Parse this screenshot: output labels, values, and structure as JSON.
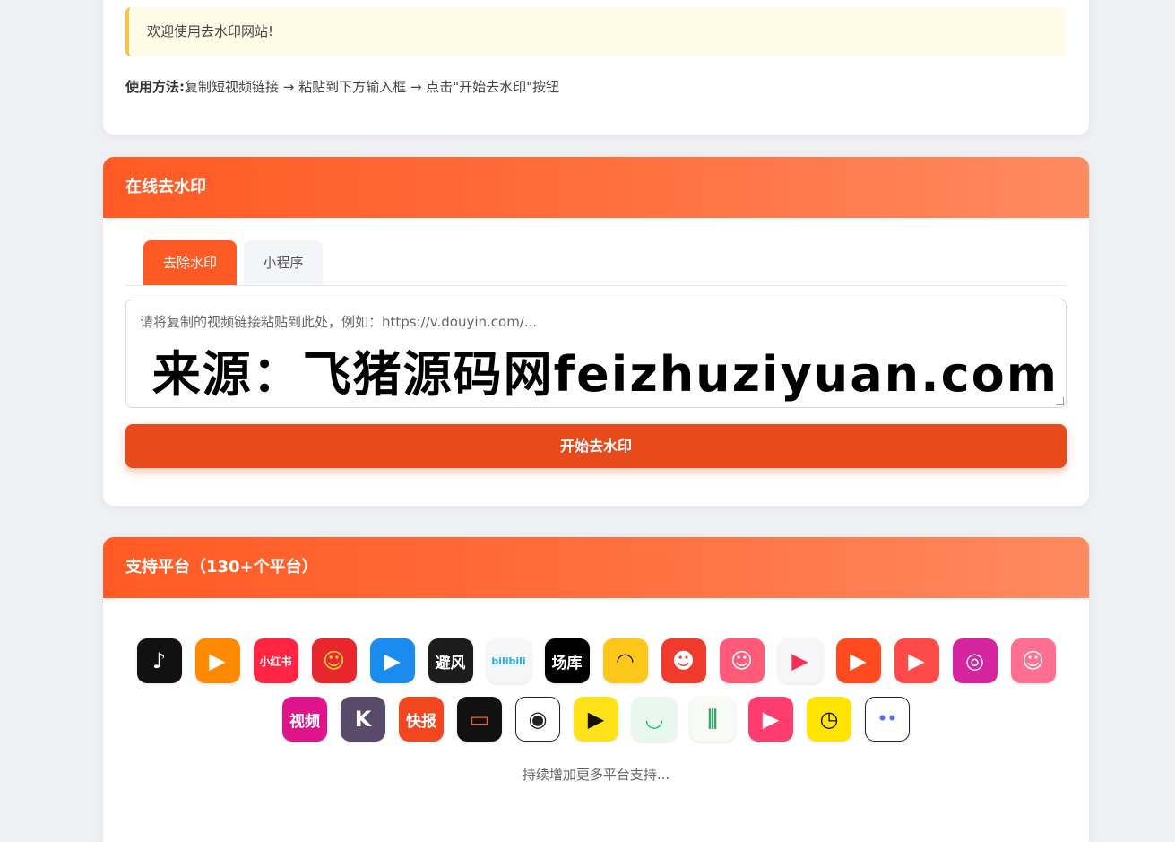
{
  "intro": {
    "notice": "欢迎使用去水印网站!",
    "usage_label": "使用方法:",
    "usage_text": "复制短视频链接 → 粘贴到下方输入框 → 点击\"开始去水印\"按钮"
  },
  "tool": {
    "title": "在线去水印",
    "tabs": [
      {
        "label": "去除水印",
        "active": true
      },
      {
        "label": "小程序",
        "active": false
      }
    ],
    "input_placeholder": "请将复制的视频链接粘贴到此处，例如：https://v.douyin.com/...",
    "watermark": "来源：飞猪源码网feizhuziyuan.com",
    "start_button": "开始去水印"
  },
  "platforms": {
    "title": "支持平台（130+个平台）",
    "more": "持续增加更多平台支持...",
    "row1": [
      {
        "icon": "douyin-icon",
        "label": "♪",
        "bg": "#111111",
        "fg": "#ffffff"
      },
      {
        "icon": "kuaishou-icon",
        "label": "▶",
        "bg": "#ff8a00",
        "fg": "#ffffff"
      },
      {
        "icon": "xiaohongshu-icon",
        "label": "小红书",
        "bg": "#ff2442",
        "fg": "#ffffff"
      },
      {
        "icon": "manga-icon",
        "label": "☺",
        "bg": "#e8262e",
        "fg": "#ffd43b"
      },
      {
        "icon": "player-icon",
        "label": "▶",
        "bg": "#1a8cf0",
        "fg": "#ffffff"
      },
      {
        "icon": "bifeng-icon",
        "label": "避风",
        "bg": "#1c1c1c",
        "fg": "#ffffff"
      },
      {
        "icon": "bilibili-icon",
        "label": "bilibili",
        "bg": "#f4f6f8",
        "fg": "#23ade5"
      },
      {
        "icon": "changku-icon",
        "label": "场库",
        "bg": "#000000",
        "fg": "#ffffff"
      },
      {
        "icon": "yellow-arch-icon",
        "label": "◠",
        "bg": "#ffc61a",
        "fg": "#222222"
      },
      {
        "icon": "monkey-icon",
        "label": "☻",
        "bg": "#ef3a2c",
        "fg": "#ffffff"
      },
      {
        "icon": "cartoon-face-icon",
        "label": "☺",
        "bg": "#ff5a7a",
        "fg": "#ffffff"
      },
      {
        "icon": "play-triangle-icon",
        "label": "▶",
        "bg": "#f6f6f8",
        "fg": "#ff2d55"
      },
      {
        "icon": "huoshan-icon",
        "label": "▶",
        "bg": "#ff4b1f",
        "fg": "#ffffff"
      },
      {
        "icon": "frame-play-icon",
        "label": "▶",
        "bg": "#ff4a4a",
        "fg": "#ffffff"
      },
      {
        "icon": "instagram-icon",
        "label": "◎",
        "bg": "#d6249f",
        "fg": "#ffffff"
      },
      {
        "icon": "laughing-face-icon",
        "label": "☺",
        "bg": "#ff6f91",
        "fg": "#ffffff"
      }
    ],
    "row2": [
      {
        "icon": "tencent-video-icon",
        "label": "视频",
        "bg": "#e0148a",
        "fg": "#ffffff"
      },
      {
        "icon": "k-icon",
        "label": "K",
        "bg": "#5a4a6a",
        "fg": "#ffffff"
      },
      {
        "icon": "kuaibao-icon",
        "label": "快报",
        "bg": "#f2461e",
        "fg": "#ffffff"
      },
      {
        "icon": "video-frame-icon",
        "label": "▭",
        "bg": "#111111",
        "fg": "#ff5a24"
      },
      {
        "icon": "eye-icon",
        "label": "◉",
        "bg": "#ffffff",
        "fg": "#222222"
      },
      {
        "icon": "yellow-play-icon",
        "label": "▶",
        "bg": "#ffe21a",
        "fg": "#111111"
      },
      {
        "icon": "bowl-icon",
        "label": "◡",
        "bg": "#e9f8ef",
        "fg": "#14b48c"
      },
      {
        "icon": "bamboo-icon",
        "label": "⫼",
        "bg": "#f7faf5",
        "fg": "#3aa36a"
      },
      {
        "icon": "camera-play-icon",
        "label": "▶",
        "bg": "#ff3c6e",
        "fg": "#ffffff"
      },
      {
        "icon": "timer-play-icon",
        "label": "◷",
        "bg": "#ffe400",
        "fg": "#111111"
      },
      {
        "icon": "chat-bubble-icon",
        "label": "••",
        "bg": "#ffffff",
        "fg": "#5b6cff"
      }
    ]
  }
}
